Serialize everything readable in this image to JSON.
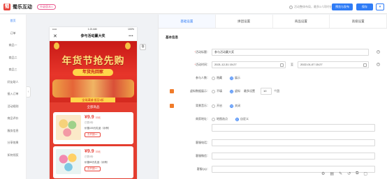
{
  "app": {
    "logo_mark": "蜀",
    "name": "蜀乐互动",
    "version_badge": "升级版本◇"
  },
  "header": {
    "tip": "活动整体布局，最多3人同时在线",
    "publish_label": "预览与发布",
    "save_label": "保存",
    "more_label": "▾"
  },
  "sidebar": {
    "items": [
      {
        "label": "首页",
        "active": true
      },
      {
        "label": "订单"
      },
      {
        "label": "商品一"
      },
      {
        "label": "商品二"
      },
      {
        "label": "商品三"
      },
      {
        "label": "好友助人"
      },
      {
        "label": "接入订单"
      },
      {
        "label": "活动规则"
      },
      {
        "label": "商品评价"
      },
      {
        "label": "服务信息"
      },
      {
        "label": "分享效果"
      },
      {
        "label": "如何领奖"
      }
    ],
    "collapse": "‹"
  },
  "phone": {
    "status_left": "•••••",
    "status_time": "1:21 AM",
    "status_right": "100%",
    "close": "✕",
    "title": "参与活动赢大奖",
    "menu": "•••",
    "banner_title": "年货节抢先购",
    "banner_sub": "年货先回家",
    "banner_foot": "全场满减·低至5折",
    "list_head": "全部商品",
    "products": [
      {
        "price": "¥9.9",
        "orig": "33元",
        "sold": "已售0份",
        "name": "价值100元礼品（示例）",
        "buy": "去开团>>"
      },
      {
        "price": "¥9.9",
        "orig": "33元",
        "sold": "已售0份",
        "name": "价值50元礼品（示例）",
        "buy": "去开团>>"
      }
    ],
    "side_icon": "⧉"
  },
  "panel": {
    "tabs": [
      {
        "label": "基础设置",
        "active": true
      },
      {
        "label": "拼团设置"
      },
      {
        "label": "商品设置"
      },
      {
        "label": "高级设置"
      }
    ],
    "section_title": "基本信息",
    "activity_title_label": "活动标题",
    "activity_title_value": "参与活动赢大奖",
    "activity_time_label": "活动时间",
    "start_time": "2021-12-31 15:27",
    "time_sep": "至",
    "end_time": "2022-01-07 15:27",
    "participants_label": "参与人数",
    "participants_options": [
      "隐藏",
      "展示"
    ],
    "participants_selected": 1,
    "virtual_label": "虚拟数据展示",
    "virtual_options": [
      "不填",
      "虚拟",
      "最多设置"
    ],
    "virtual_count": "10",
    "virtual_unit": "个团",
    "music_label": "背景音乐",
    "music_options": [
      "开启",
      "关闭"
    ],
    "music_selected": 1,
    "address_label": "商家地址",
    "address_options": [
      "地图选点",
      "自定义"
    ],
    "address_selected": 1,
    "address_value": "",
    "phone_label": "客服电话",
    "phone_value": "",
    "wechat_label": "客服微信",
    "wechat_value": "",
    "qq_label": "客服QQ",
    "qq_value": "",
    "required_mark": "*",
    "help": "?",
    "colon": "："
  },
  "footer_icons": [
    "⚙",
    "▤",
    "✎",
    "↺",
    "⧉",
    "▢"
  ]
}
